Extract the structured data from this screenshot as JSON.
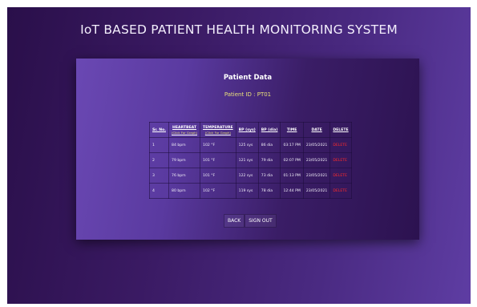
{
  "app": {
    "title": "IoT BASED PATIENT HEALTH MONITORING SYSTEM"
  },
  "card": {
    "title": "Patient Data",
    "patient_id": "Patient ID : PT01"
  },
  "table": {
    "headers": {
      "sr": "Sr. No.",
      "heartbeat": "HEARTBEAT",
      "heartbeat_sub": "(Click For Graph)",
      "temperature": "TEMPERATURE",
      "temperature_sub": "(Click For Graph)",
      "bp_sys": "BP (sys)",
      "bp_dia": "BP (dia)",
      "time": "TIME",
      "date": "DATE",
      "delete": "DELETE"
    },
    "rows": [
      {
        "sr": "1",
        "heartbeat": "84 bpm",
        "temperature": "102 °F",
        "bp_sys": "125 sys",
        "bp_dia": "86 dia",
        "time": "03:17 PM",
        "date": "23/05/2021",
        "delete": "DELETE"
      },
      {
        "sr": "2",
        "heartbeat": "79 bpm",
        "temperature": "101 °F",
        "bp_sys": "121 sys",
        "bp_dia": "79 dia",
        "time": "02:07 PM",
        "date": "23/05/2021",
        "delete": "DELETE"
      },
      {
        "sr": "3",
        "heartbeat": "76 bpm",
        "temperature": "101 °F",
        "bp_sys": "122 sys",
        "bp_dia": "73 dia",
        "time": "01:13 PM",
        "date": "23/05/2021",
        "delete": "DELETE"
      },
      {
        "sr": "4",
        "heartbeat": "80 bpm",
        "temperature": "102 °F",
        "bp_sys": "119 sys",
        "bp_dia": "78 dia",
        "time": "12:44 PM",
        "date": "23/05/2021",
        "delete": "DELETE"
      }
    ]
  },
  "buttons": {
    "back": "BACK",
    "sign_out": "SIGN OUT"
  },
  "colors": {
    "accent_yellow": "#e9e07a",
    "delete_red": "#ff2a2a",
    "bg_purple": "#3a1a63"
  }
}
